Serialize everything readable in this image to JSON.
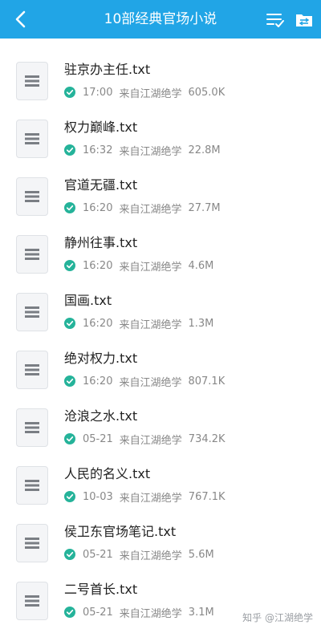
{
  "header": {
    "title": "10部经典官场小说",
    "background_color": "#21a5e6",
    "back_icon": "chevron-left-icon",
    "sort_icon": "list-check-icon",
    "folder_icon": "folder-swap-icon"
  },
  "status_check_color": "#25b39a",
  "files": [
    {
      "name": "驻京办主任.txt",
      "time": "17:00",
      "source": "来自江湖绝学",
      "size": "605.0K"
    },
    {
      "name": "权力巅峰.txt",
      "time": "16:32",
      "source": "来自江湖绝学",
      "size": "22.8M"
    },
    {
      "name": "官道无疆.txt",
      "time": "16:20",
      "source": "来自江湖绝学",
      "size": "27.7M"
    },
    {
      "name": "静州往事.txt",
      "time": "16:20",
      "source": "来自江湖绝学",
      "size": "4.6M"
    },
    {
      "name": "国画.txt",
      "time": "16:20",
      "source": "来自江湖绝学",
      "size": "1.3M"
    },
    {
      "name": "绝对权力.txt",
      "time": "16:20",
      "source": "来自江湖绝学",
      "size": "807.1K"
    },
    {
      "name": "沧浪之水.txt",
      "time": "05-21",
      "source": "来自江湖绝学",
      "size": "734.2K"
    },
    {
      "name": "人民的名义.txt",
      "time": "10-03",
      "source": "来自江湖绝学",
      "size": "767.1K"
    },
    {
      "name": "侯卫东官场笔记.txt",
      "time": "05-21",
      "source": "来自江湖绝学",
      "size": "5.6M"
    },
    {
      "name": "二号首长.txt",
      "time": "05-21",
      "source": "来自江湖绝学",
      "size": "3.1M"
    }
  ],
  "watermark": "知乎 @江湖绝学"
}
